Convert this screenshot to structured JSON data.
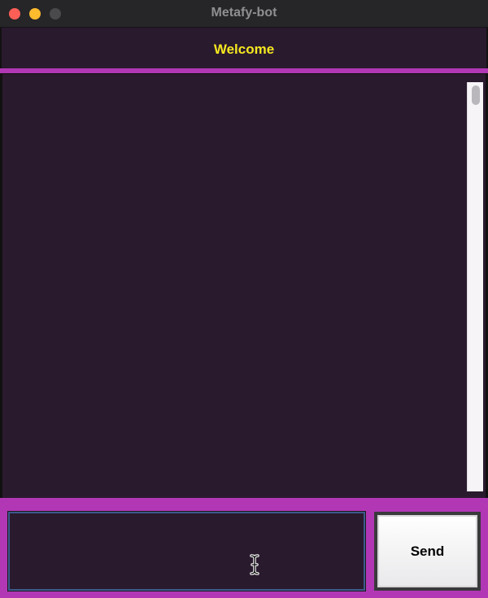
{
  "window": {
    "title": "Metafy-bot"
  },
  "header": {
    "title": "Welcome",
    "title_color": "#f5e820"
  },
  "colors": {
    "background": "#2a1a2e",
    "accent": "#b237b5"
  },
  "chat": {
    "messages": []
  },
  "input": {
    "value": "",
    "placeholder": ""
  },
  "send_button": {
    "label": "Send"
  }
}
